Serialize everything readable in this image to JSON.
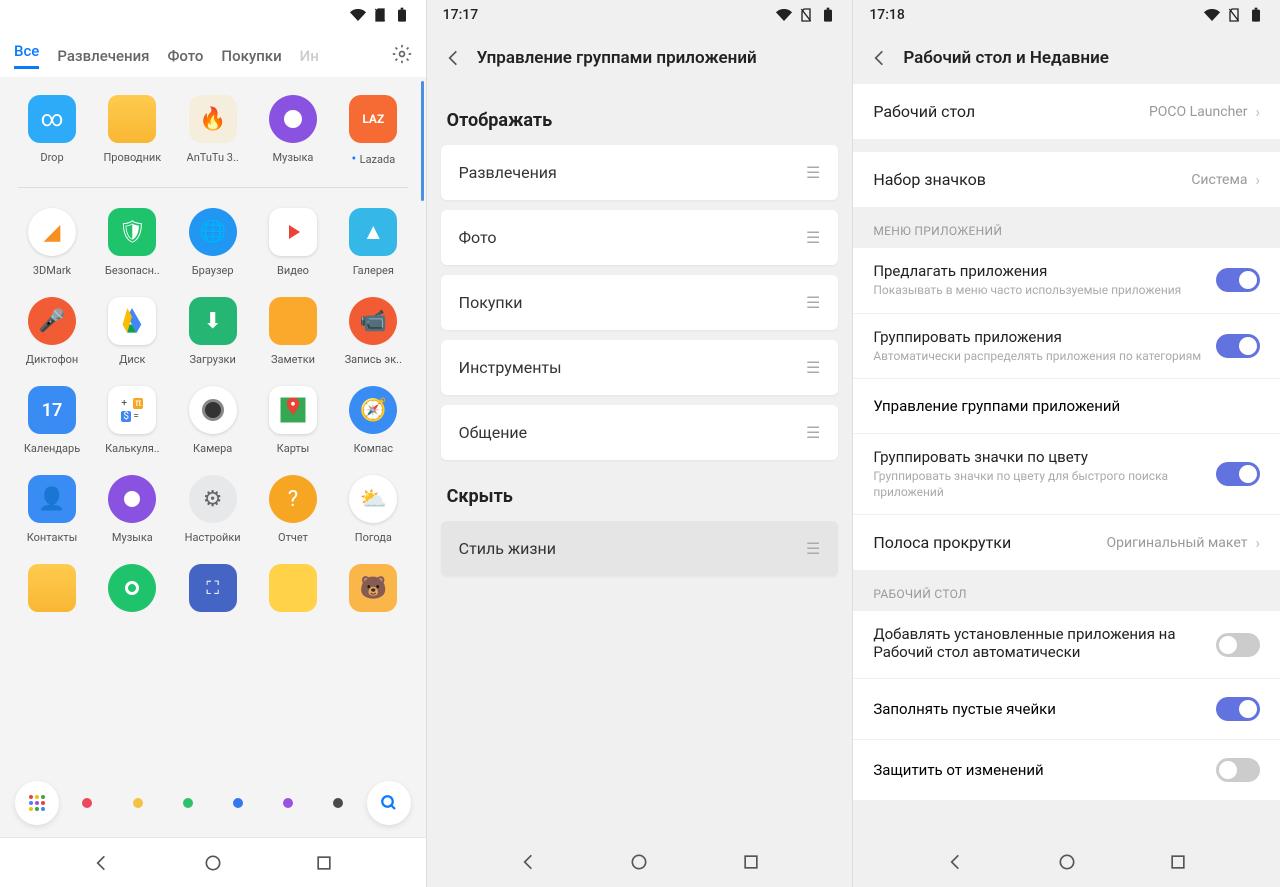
{
  "screen1": {
    "tabs": [
      "Все",
      "Развлечения",
      "Фото",
      "Покупки",
      "Ин"
    ],
    "apps_row1": [
      {
        "label": "Drop"
      },
      {
        "label": "Проводник"
      },
      {
        "label": "AnTuTu 3.."
      },
      {
        "label": "Музыка"
      },
      {
        "label": "Lazada",
        "new": true
      }
    ],
    "apps_rest": [
      {
        "label": "3DMark"
      },
      {
        "label": "Безопасн.."
      },
      {
        "label": "Браузер"
      },
      {
        "label": "Видео"
      },
      {
        "label": "Галерея"
      },
      {
        "label": "Диктофон"
      },
      {
        "label": "Диск"
      },
      {
        "label": "Загрузки"
      },
      {
        "label": "Заметки"
      },
      {
        "label": "Запись эк.."
      },
      {
        "label": "Календарь"
      },
      {
        "label": "Калькуля.."
      },
      {
        "label": "Камера"
      },
      {
        "label": "Карты"
      },
      {
        "label": "Компас"
      },
      {
        "label": "Контакты"
      },
      {
        "label": "Музыка"
      },
      {
        "label": "Настройки"
      },
      {
        "label": "Отчет"
      },
      {
        "label": "Погода"
      }
    ],
    "calendar_day": "17",
    "dock_colors": [
      "#ea4a59",
      "#f5c143",
      "#2ec16c",
      "#3677f0",
      "#9854e0",
      "#4a4a4a"
    ]
  },
  "screen2": {
    "time": "17:17",
    "title": "Управление группами приложений",
    "sec1": "Отображать",
    "show_list": [
      "Развлечения",
      "Фото",
      "Покупки",
      "Инструменты",
      "Общение"
    ],
    "sec2": "Скрыть",
    "hide_list": [
      "Стиль жизни"
    ]
  },
  "screen3": {
    "time": "17:18",
    "title": "Рабочий стол и Недавние",
    "rows": {
      "desktop": {
        "title": "Рабочий стол",
        "value": "POCO Launcher"
      },
      "iconset": {
        "title": "Набор значков",
        "value": "Система"
      },
      "group1_label": "МЕНЮ ПРИЛОЖЕНИЙ",
      "suggest": {
        "title": "Предлагать приложения",
        "sub": "Показывать в меню часто используемые приложения",
        "on": true
      },
      "groupapps": {
        "title": "Группировать приложения",
        "sub": "Автоматически распределять приложения по категориям",
        "on": true
      },
      "manage": {
        "title": "Управление группами приложений"
      },
      "groupcolor": {
        "title": "Группировать значки по цвету",
        "sub": "Группировать значки по цвету для быстрого поиска приложений",
        "on": true
      },
      "scroll": {
        "title": "Полоса прокрутки",
        "value": "Оригинальный макет"
      },
      "group2_label": "РАБОЧИЙ СТОЛ",
      "autoadd": {
        "title": "Добавлять установленные приложения на Рабочий стол автоматически",
        "on": false
      },
      "fill": {
        "title": "Заполнять пустые ячейки",
        "on": true
      },
      "protect": {
        "title": "Защитить от изменений",
        "on": false
      }
    }
  }
}
